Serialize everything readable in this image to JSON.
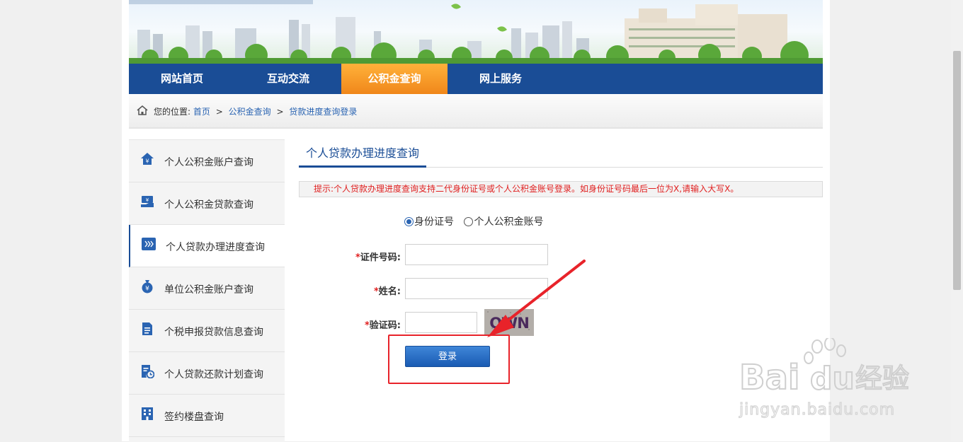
{
  "nav": {
    "items": [
      {
        "label": "网站首页",
        "active": false
      },
      {
        "label": "互动交流",
        "active": false
      },
      {
        "label": "公积金查询",
        "active": true
      },
      {
        "label": "网上服务",
        "active": false
      }
    ]
  },
  "breadcrumb": {
    "prefix": "您的位置:",
    "items": [
      "首页",
      "公积金查询",
      "贷款进度查询登录"
    ],
    "separator": ">"
  },
  "sidebar": {
    "items": [
      {
        "label": "个人公积金账户查询",
        "icon": "house-yen-icon",
        "active": false
      },
      {
        "label": "个人公积金贷款查询",
        "icon": "hand-money-icon",
        "active": false
      },
      {
        "label": "个人贷款办理进度查询",
        "icon": "progress-arrows-icon",
        "active": true
      },
      {
        "label": "单位公积金账户查询",
        "icon": "money-bag-icon",
        "active": false
      },
      {
        "label": "个税申报贷款信息查询",
        "icon": "document-icon",
        "active": false
      },
      {
        "label": "个人贷款还款计划查询",
        "icon": "schedule-clock-icon",
        "active": false
      },
      {
        "label": "签约楼盘查询",
        "icon": "building-icon",
        "active": false
      }
    ]
  },
  "content": {
    "title": "个人贷款办理进度查询",
    "tip": "提示:个人贷款办理进度查询支持二代身份证号或个人公积金账号登录。如身份证号码最后一位为X,请输入大写X。"
  },
  "form": {
    "radio_options": [
      {
        "label": "身份证号",
        "checked": true
      },
      {
        "label": "个人公积金账号",
        "checked": false
      }
    ],
    "required_mark": "*",
    "fields": {
      "id_number": {
        "label": "证件号码:",
        "value": ""
      },
      "name": {
        "label": "姓名:",
        "value": ""
      },
      "captcha": {
        "label": "验证码:",
        "value": ""
      }
    },
    "captcha_text": "QWN",
    "login_label": "登录"
  },
  "watermark": {
    "brand": "Bai",
    "brand_suffix": "du",
    "product": "经验",
    "url": "jingyan.baidu.com"
  },
  "colors": {
    "nav_bg": "#1a4d96",
    "nav_active": "#f0871a",
    "link": "#2a64b2",
    "tip_red": "#e02020",
    "highlight_red": "#e8232a",
    "button_blue": "#1a5bb3"
  }
}
